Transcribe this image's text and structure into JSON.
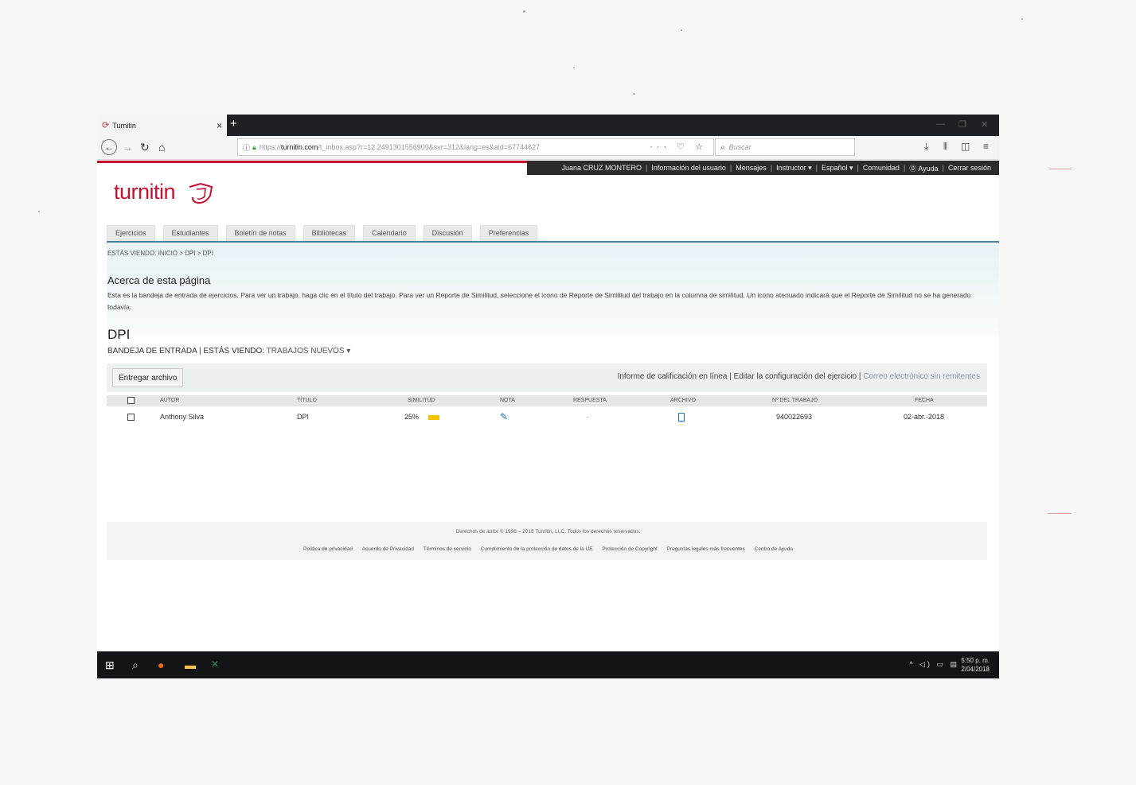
{
  "browser": {
    "tab_title": "Turnitin",
    "tab_close": "×",
    "new_tab": "+",
    "url_prefix": "https://",
    "url_host": "turnitin.com",
    "url_path": "/t_inbox.asp?r=12.2491301556909&svr=312&lang=es&aid=67744627",
    "search_placeholder": "Buscar",
    "more_actions": "··· ♡ ☆"
  },
  "top_menu": {
    "user": "Juana CRUZ MONTERO",
    "user_info": "Información del usuario",
    "messages": "Mensajes",
    "role": "Instructor ▾",
    "language": "Español ▾",
    "community": "Comunidad",
    "help": "⓪ Ayuda",
    "logout": "Cerrar sesión"
  },
  "logo": {
    "text": "turnitin",
    "color": "#c8102e"
  },
  "tabs": [
    "Ejercicios",
    "Estudiantes",
    "Boletín de notas",
    "Bibliotecas",
    "Calendario",
    "Discusión",
    "Preferencias"
  ],
  "breadcrumb": "ESTÁS VIENDO: INICIO > DPI > DPI",
  "about": {
    "title": "Acerca de esta página",
    "text": "Esta es la bandeja de entrada de ejercicios. Para ver un trabajo, haga clic en el título del trabajo. Para ver un Reporte de Similitud, seleccione el icono de Reporte de Similitud del trabajo en la columna de similitud. Un icono atenuado indicará que el Reporte de Similitud no se ha generado todavía."
  },
  "course_title": "DPI",
  "inbox": {
    "prefix": "BANDEJA DE ENTRADA | ESTÁS VIENDO: ",
    "view": "TRABAJOS NUEVOS ▾"
  },
  "actions": {
    "submit_button": "Entregar archivo",
    "grade_report": "Informe de calificación en línea",
    "edit_settings": "Editar la configuración del ejercicio",
    "email": "Correo electrónico sin remitentes",
    "separator": " | "
  },
  "table": {
    "headers": {
      "author": "AUTOR",
      "title": "TÍTULO",
      "similarity": "SIMILITUD",
      "grade": "NOTA",
      "response": "RESPUESTA",
      "file": "ARCHIVO",
      "paper_id": "Nº DEL TRABAJO",
      "date": "FECHA"
    },
    "rows": [
      {
        "author": "Anthony Silva",
        "title": "DPI",
        "similarity": "25%",
        "response": "-",
        "paper_id": "940022693",
        "date": "02-abr.-2018"
      }
    ],
    "similarity_color": "#f3c300"
  },
  "footer": {
    "copyright": "Derechos de autor © 1998 – 2018 Turnitin, LLC. Todos los derechos reservados.",
    "links": [
      "Política de privacidad",
      "Acuerdo de Privacidad",
      "Términos de servicio",
      "Cumplimiento de la protección de datos de la UE",
      "Protección de Copyright",
      "Preguntas legales más frecuentes",
      "Centro de Ayuda"
    ]
  },
  "taskbar": {
    "time": "5:50 p. m.",
    "date": "2/04/2018"
  }
}
